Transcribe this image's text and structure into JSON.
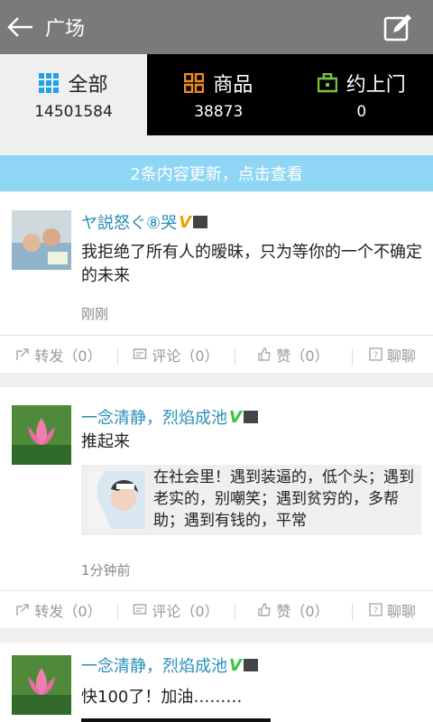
{
  "header": {
    "title": "广场"
  },
  "tabs": [
    {
      "label": "全部",
      "count": "14501584",
      "icon": "grid-icon",
      "color": "#1aa3e8"
    },
    {
      "label": "商品",
      "count": "38873",
      "icon": "squares-icon",
      "color": "#f08a20"
    },
    {
      "label": "约上门",
      "count": "0",
      "icon": "briefcase-icon",
      "color": "#7ac142"
    }
  ],
  "banner": {
    "text": "2条内容更新，点击查看"
  },
  "posts": [
    {
      "name": "ヤ説怒ぐ⑧哭",
      "content": "我拒绝了所有人的暧昧，只为等你的一个不确定的未来",
      "time": "刚刚",
      "actions": {
        "forward": "转发（0）",
        "comment": "评论（0）",
        "like": "赞（0）",
        "chat": "聊聊"
      }
    },
    {
      "name": "一念清静，烈焰成池",
      "content": "推起来",
      "quote": "在社会里！遇到装逼的，低个头；遇到老实的，别嘲笑；遇到贫穷的，多帮助；遇到有钱的，平常",
      "time": "1分钟前",
      "actions": {
        "forward": "转发（0）",
        "comment": "评论（0）",
        "like": "赞（0）",
        "chat": "聊聊"
      }
    },
    {
      "name": "一念清静，烈焰成池",
      "content": "快100了！加油………"
    }
  ]
}
